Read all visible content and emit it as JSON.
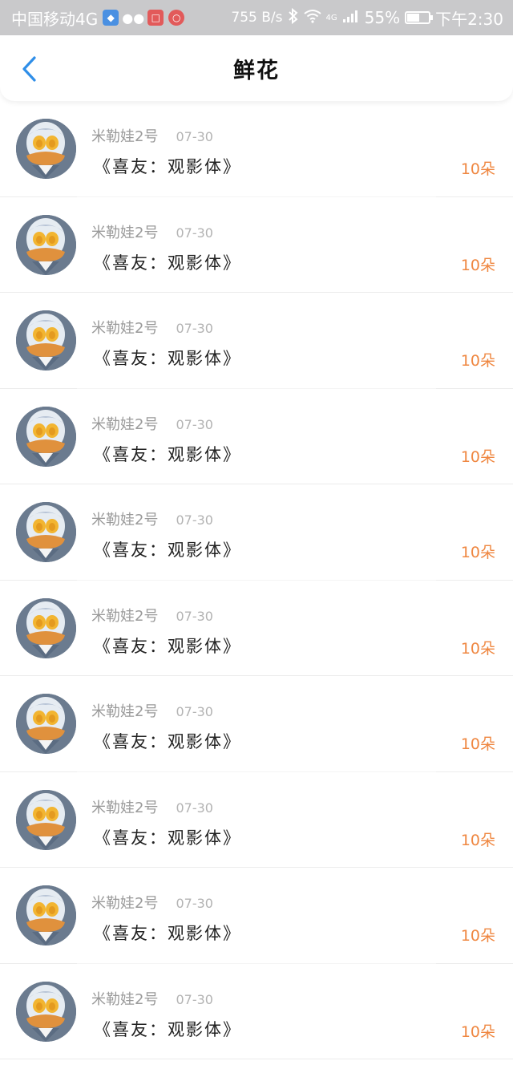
{
  "status_bar": {
    "carrier": "中国移动4G",
    "speed": "755 B/s",
    "network": "4G",
    "battery": "55%",
    "battery_level": 0.55,
    "time": "下午2:30"
  },
  "header": {
    "title": "鲜花",
    "back_icon": "chevron-left-icon",
    "accent_color": "#2f8ee8"
  },
  "records": [
    {
      "user": "米勒娃2号",
      "date": "07-30",
      "work": "《喜友：观影体》",
      "amount": "10朵"
    },
    {
      "user": "米勒娃2号",
      "date": "07-30",
      "work": "《喜友：观影体》",
      "amount": "10朵"
    },
    {
      "user": "米勒娃2号",
      "date": "07-30",
      "work": "《喜友：观影体》",
      "amount": "10朵"
    },
    {
      "user": "米勒娃2号",
      "date": "07-30",
      "work": "《喜友：观影体》",
      "amount": "10朵"
    },
    {
      "user": "米勒娃2号",
      "date": "07-30",
      "work": "《喜友：观影体》",
      "amount": "10朵"
    },
    {
      "user": "米勒娃2号",
      "date": "07-30",
      "work": "《喜友：观影体》",
      "amount": "10朵"
    },
    {
      "user": "米勒娃2号",
      "date": "07-30",
      "work": "《喜友：观影体》",
      "amount": "10朵"
    },
    {
      "user": "米勒娃2号",
      "date": "07-30",
      "work": "《喜友：观影体》",
      "amount": "10朵"
    },
    {
      "user": "米勒娃2号",
      "date": "07-30",
      "work": "《喜友：观影体》",
      "amount": "10朵"
    },
    {
      "user": "米勒娃2号",
      "date": "07-30",
      "work": "《喜友：观影体》",
      "amount": "10朵"
    }
  ],
  "amount_color": "#ef8741"
}
